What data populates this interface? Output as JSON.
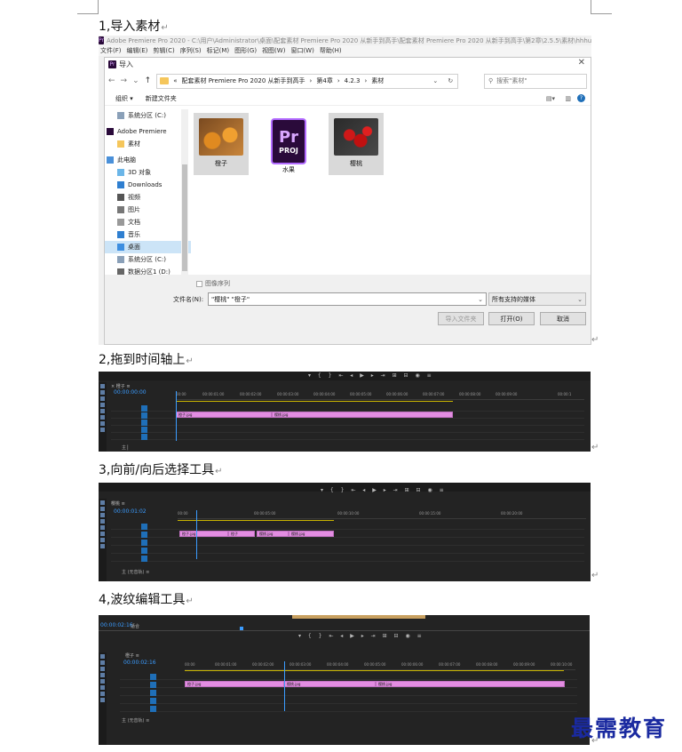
{
  "headings": {
    "h1": "1,导入素材",
    "h2": "2,拖到时间轴上",
    "h3": "3,向前/向后选择工具",
    "h4": "4,波纹编辑工具"
  },
  "para_mark": "↵",
  "app": {
    "logo": "Pr",
    "title": "Adobe Premiere Pro 2020 - C:\\用户\\Administrator\\桌面\\配套素材 Premiere Pro 2020 从新手到高手\\配套素材 Premiere Pro 2020 从新手到高手\\第2章\\2.5.5\\素材\\hhhu",
    "menu": [
      "文件(F)",
      "编辑(E)",
      "剪辑(C)",
      "序列(S)",
      "标记(M)",
      "图形(G)",
      "视图(W)",
      "窗口(W)",
      "帮助(H)"
    ]
  },
  "dialog": {
    "title": "导入",
    "close": "✕",
    "breadcrumb": [
      "«",
      "配套素材 Premiere Pro 2020 从新手到高手",
      "›",
      "第4章",
      "›",
      "4.2.3",
      "›",
      "素材"
    ],
    "search_placeholder": "搜索\"素材\"",
    "toolbar": {
      "organize": "组织 ▾",
      "new_folder": "新建文件夹"
    },
    "sidebar": [
      {
        "label": "系统分区 (C:)",
        "icon": "drive-icon"
      },
      {
        "label": "Adobe Premiere",
        "icon": "premiere-icon"
      },
      {
        "label": "素材",
        "icon": "folder-icon"
      },
      {
        "label": "此电脑",
        "icon": "computer-icon"
      },
      {
        "label": "3D 对象",
        "icon": "cube-icon"
      },
      {
        "label": "Downloads",
        "icon": "download-icon"
      },
      {
        "label": "视频",
        "icon": "video-icon"
      },
      {
        "label": "图片",
        "icon": "picture-icon"
      },
      {
        "label": "文档",
        "icon": "document-icon"
      },
      {
        "label": "音乐",
        "icon": "music-icon"
      },
      {
        "label": "桌面",
        "icon": "desktop-icon"
      },
      {
        "label": "系统分区 (C:)",
        "icon": "drive-icon"
      },
      {
        "label": "数据分区1 (D:)",
        "icon": "drive-icon"
      },
      {
        "label": "网络",
        "icon": "network-icon"
      }
    ],
    "files": [
      {
        "label": "橙子",
        "kind": "image"
      },
      {
        "label": "水果",
        "kind": "project"
      },
      {
        "label": "樱桃",
        "kind": "image"
      }
    ],
    "proj_icon": {
      "top": "Pr",
      "bottom": "PROJ"
    },
    "image_sequence": "图像序列",
    "filename_label": "文件名(N):",
    "filename_value": "\"樱桃\" \"橙子\"",
    "filetype": "所有支持的媒体",
    "buttons": {
      "import_folder": "导入文件夹",
      "open": "打开(O)",
      "cancel": "取消"
    }
  },
  "timelines": [
    {
      "tab": "× 橙子 ≡",
      "timecode": "00:00:00:00",
      "ticks": [
        "00:00",
        "00:00:01:00",
        "00:00:02:00",
        "00:00:03:00",
        "00:00:04:00",
        "00:00:05:00",
        "00:00:06:00",
        "00:00:07:00",
        "00:00:08:00",
        "00:00:09:00",
        "00:00:1"
      ],
      "clips": [
        {
          "label": "橙子.jpg"
        },
        {
          "label": "樱桃.jpg"
        }
      ],
      "bottom": "主 ▏"
    },
    {
      "tab": "樱桃 ≡",
      "timecode": "00:00:01:02",
      "ticks": [
        "00:00",
        "00:00:05:00",
        "00:00:10:00",
        "00:00:15:00",
        "00:00:20:00"
      ],
      "clips": [
        {
          "label": "橙子.jpg"
        },
        {
          "label": "橙子"
        },
        {
          "label": "樱桃.jpg"
        },
        {
          "label": "樱桃.jpg"
        }
      ],
      "bottom": "主 (无音轨) ≡"
    },
    {
      "tab": "橙子 ≡",
      "timecode": "00:00:02:16",
      "top_timecode": "00:00:02:16",
      "top_label": "适合",
      "ticks": [
        "00:00",
        "00:00:01:00",
        "00:00:02:00",
        "00:00:03:00",
        "00:00:04:00",
        "00:00:05:00",
        "00:00:06:00",
        "00:00:07:00",
        "00:00:08:00",
        "00:00:09:00",
        "00:00:10:00"
      ],
      "clips": [
        {
          "label": "橙子.jpg"
        },
        {
          "label": "樱桃.jpg"
        },
        {
          "label": "樱桃.jpg"
        }
      ],
      "bottom": "主 (无音轨) ≡"
    }
  ],
  "watermark": "最需教育"
}
